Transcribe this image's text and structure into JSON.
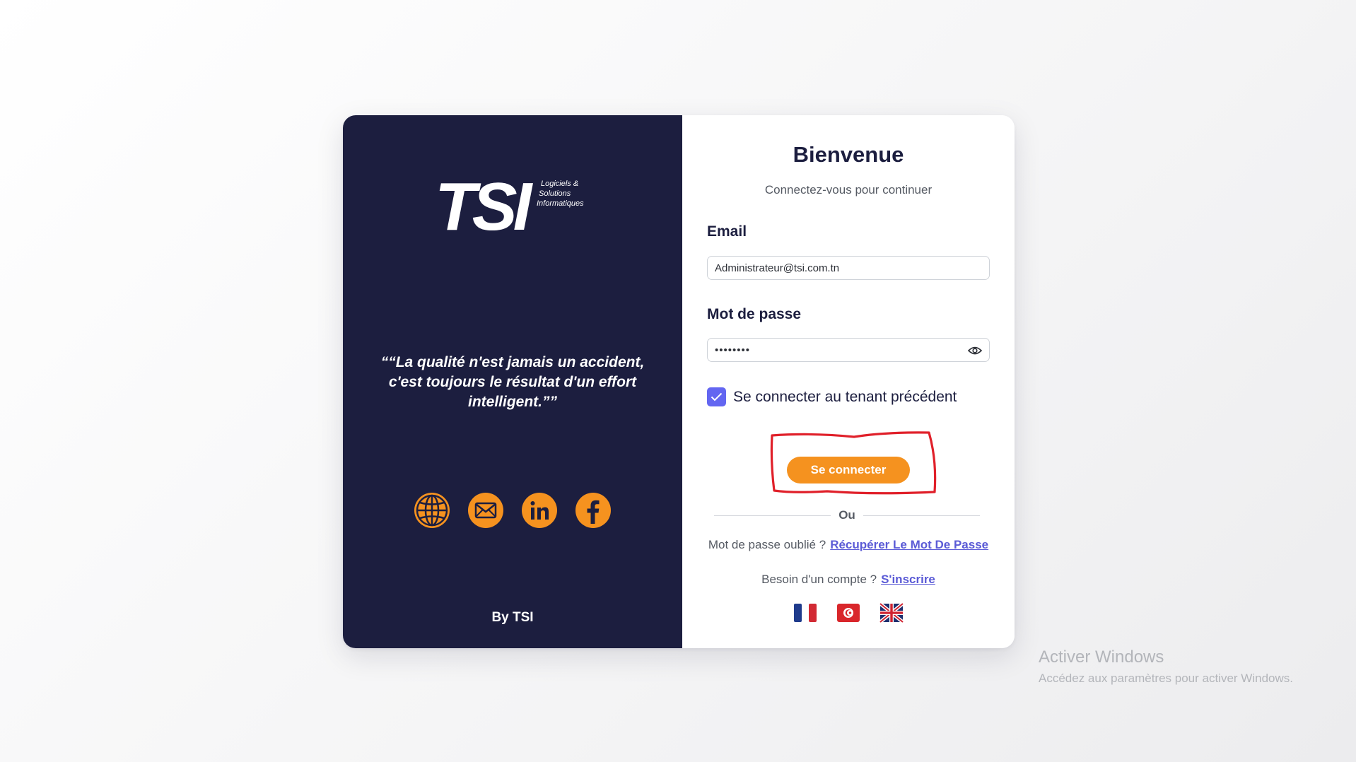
{
  "brand": {
    "logo_text": "TSI",
    "tagline_lines": [
      "Logiciels &",
      "Solutions",
      "Informatiques"
    ]
  },
  "left_panel": {
    "quote": "““La qualité n'est jamais un accident, c'est toujours le résultat d'un effort intelligent.””",
    "socials": [
      {
        "name": "website",
        "icon": "globe-icon"
      },
      {
        "name": "email",
        "icon": "envelope-icon"
      },
      {
        "name": "linkedin",
        "icon": "linkedin-icon"
      },
      {
        "name": "facebook",
        "icon": "facebook-icon"
      }
    ],
    "byline": "By TSI"
  },
  "form": {
    "title": "Bienvenue",
    "subtitle": "Connectez-vous pour continuer",
    "email_label": "Email",
    "email_value": "Administrateur@tsi.com.tn",
    "password_label": "Mot de passe",
    "password_value": "••••••••",
    "remember_label": "Se connecter au tenant précédent",
    "remember_checked": true,
    "submit_label": "Se connecter",
    "divider_text": "Ou",
    "forgot_text": "Mot de passe oublié ?",
    "forgot_link": "Récupérer Le Mot De Passe",
    "signup_text": "Besoin d'un compte ?",
    "signup_link": "S'inscrire",
    "languages": [
      "fr",
      "tn",
      "en"
    ]
  },
  "watermark": {
    "title": "Activer Windows",
    "subtitle": "Accédez aux paramètres pour activer Windows."
  },
  "colors": {
    "navy": "#1c1e3f",
    "accent_orange": "#f5921f",
    "link": "#5b5bd6",
    "checkbox": "#6366f1",
    "annotation_red": "#e0202a"
  }
}
